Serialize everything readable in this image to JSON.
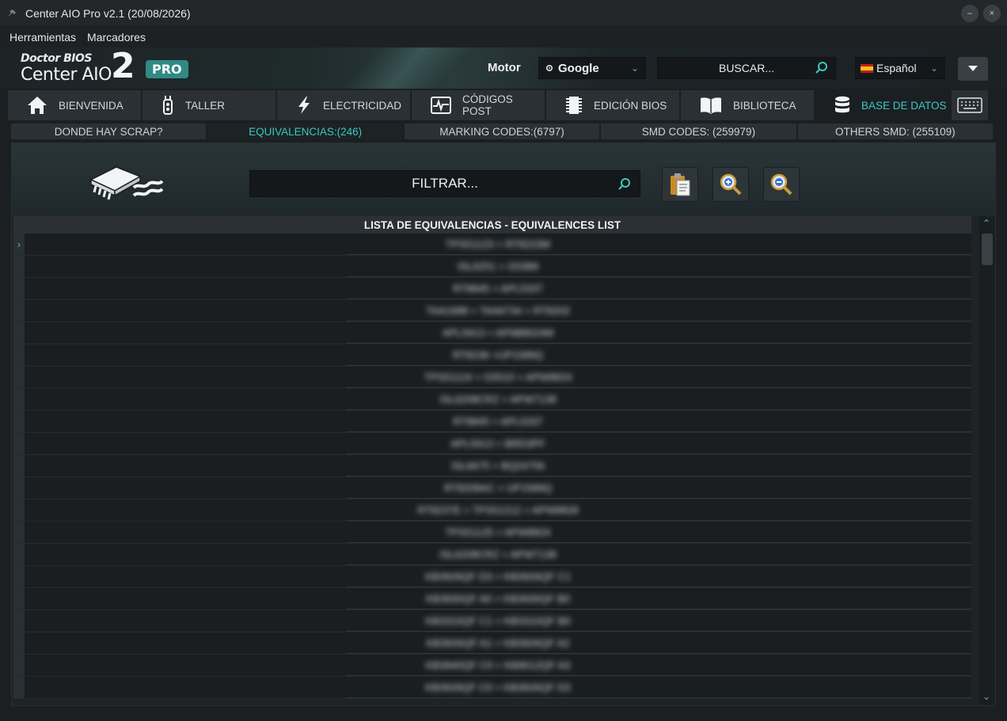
{
  "window": {
    "title": "Center AIO Pro v2.1 (20/08/2026)",
    "minimize": "–",
    "close": "×"
  },
  "menu": [
    "Herramientas",
    "Marcadores"
  ],
  "header": {
    "logo_top": "Doctor BIOS",
    "logo_main": "Center AIO",
    "logo_number": "2",
    "logo_badge": "PRO",
    "motor_label": "Motor",
    "motor_value": "Google",
    "search_placeholder": "BUSCAR...",
    "language": "Español"
  },
  "nav_tabs": [
    {
      "label": "BIENVENIDA",
      "icon": "home-icon"
    },
    {
      "label": "TALLER",
      "icon": "tool-icon"
    },
    {
      "label": "ELECTRICIDAD",
      "icon": "lightning-icon"
    },
    {
      "label": "CÓDIGOS POST",
      "icon": "post-code-icon"
    },
    {
      "label": "EDICIÓN BIOS",
      "icon": "chip-icon"
    },
    {
      "label": "BIBLIOTECA",
      "icon": "book-icon"
    },
    {
      "label": "BASE DE DATOS",
      "icon": "database-icon",
      "active": true
    }
  ],
  "sub_tabs": [
    {
      "label": "DONDE HAY SCRAP?"
    },
    {
      "label": "EQUIVALENCIAS:(246)",
      "active": true
    },
    {
      "label": "MARKING CODES:(6797)"
    },
    {
      "label": "SMD CODES: (259979)"
    },
    {
      "label": "OTHERS SMD: (255109)"
    }
  ],
  "filter": {
    "placeholder": "FILTRAR..."
  },
  "list": {
    "header": "LISTA DE EQUIVALENCIAS - EQUIVALENCES LIST",
    "rows": [
      "TPS51123 = RT8223M",
      "ISL6251 = G5389",
      "RT8845 = APL5337",
      "TAA1688 = TAA6734 = RT8202",
      "APL5913 = AP6B8024M",
      "RT8236 =UP1589Q",
      "TPS51124 = G5510 = APW8824",
      "ISL6208CRZ = APW7138",
      "RT8845 = APL5337",
      "APL5913 = BRD3PF",
      "ISL6675 = BQ24756",
      "RT8208AC = UP1589Q",
      "RT8237E = TPS51212 = APW8828",
      "TPS51125 = APW8824",
      "ISL6208CRZ = APW7138",
      "KB3926QF D3 = KB3926QF C1",
      "KB3930QF A0 = KB3930QF B0",
      "KB3310QF C1 = KB3310QF B0",
      "KB3926QF A1 = KB3926QF A2",
      "KB3940QF C0 = KB9012QF A3",
      "KB3926QF C0 = KB3926QF D2"
    ]
  }
}
